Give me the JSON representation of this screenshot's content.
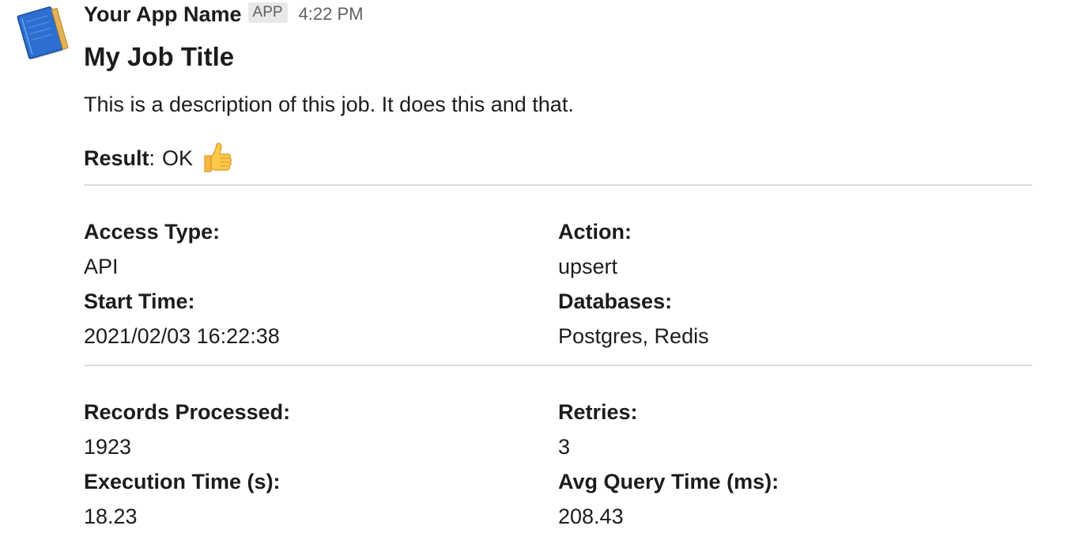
{
  "message": {
    "app_name": "Your App Name",
    "badge": "APP",
    "timestamp": "4:22 PM",
    "avatar_icon": "notebook-icon",
    "title": "My Job Title",
    "description": "This is a description of this job. It does this and that.",
    "result": {
      "label": "Result",
      "separator": ":",
      "value": "OK",
      "emoji_icon": "thumbs-up-icon"
    },
    "section1": [
      {
        "label": "Access Type:",
        "value": "API"
      },
      {
        "label": "Action:",
        "value": "upsert"
      },
      {
        "label": "Start Time:",
        "value": "2021/02/03 16:22:38"
      },
      {
        "label": "Databases:",
        "value": "Postgres, Redis"
      }
    ],
    "section2": [
      {
        "label": "Records Processed:",
        "value": "1923"
      },
      {
        "label": "Retries:",
        "value": "3"
      },
      {
        "label": "Execution Time (s):",
        "value": "18.23"
      },
      {
        "label": "Avg Query Time (ms):",
        "value": "208.43"
      }
    ]
  },
  "colors": {
    "text": "#1d1c1d",
    "muted": "#616061",
    "divider": "#dddddd",
    "badge_bg": "#e8e8e8"
  }
}
